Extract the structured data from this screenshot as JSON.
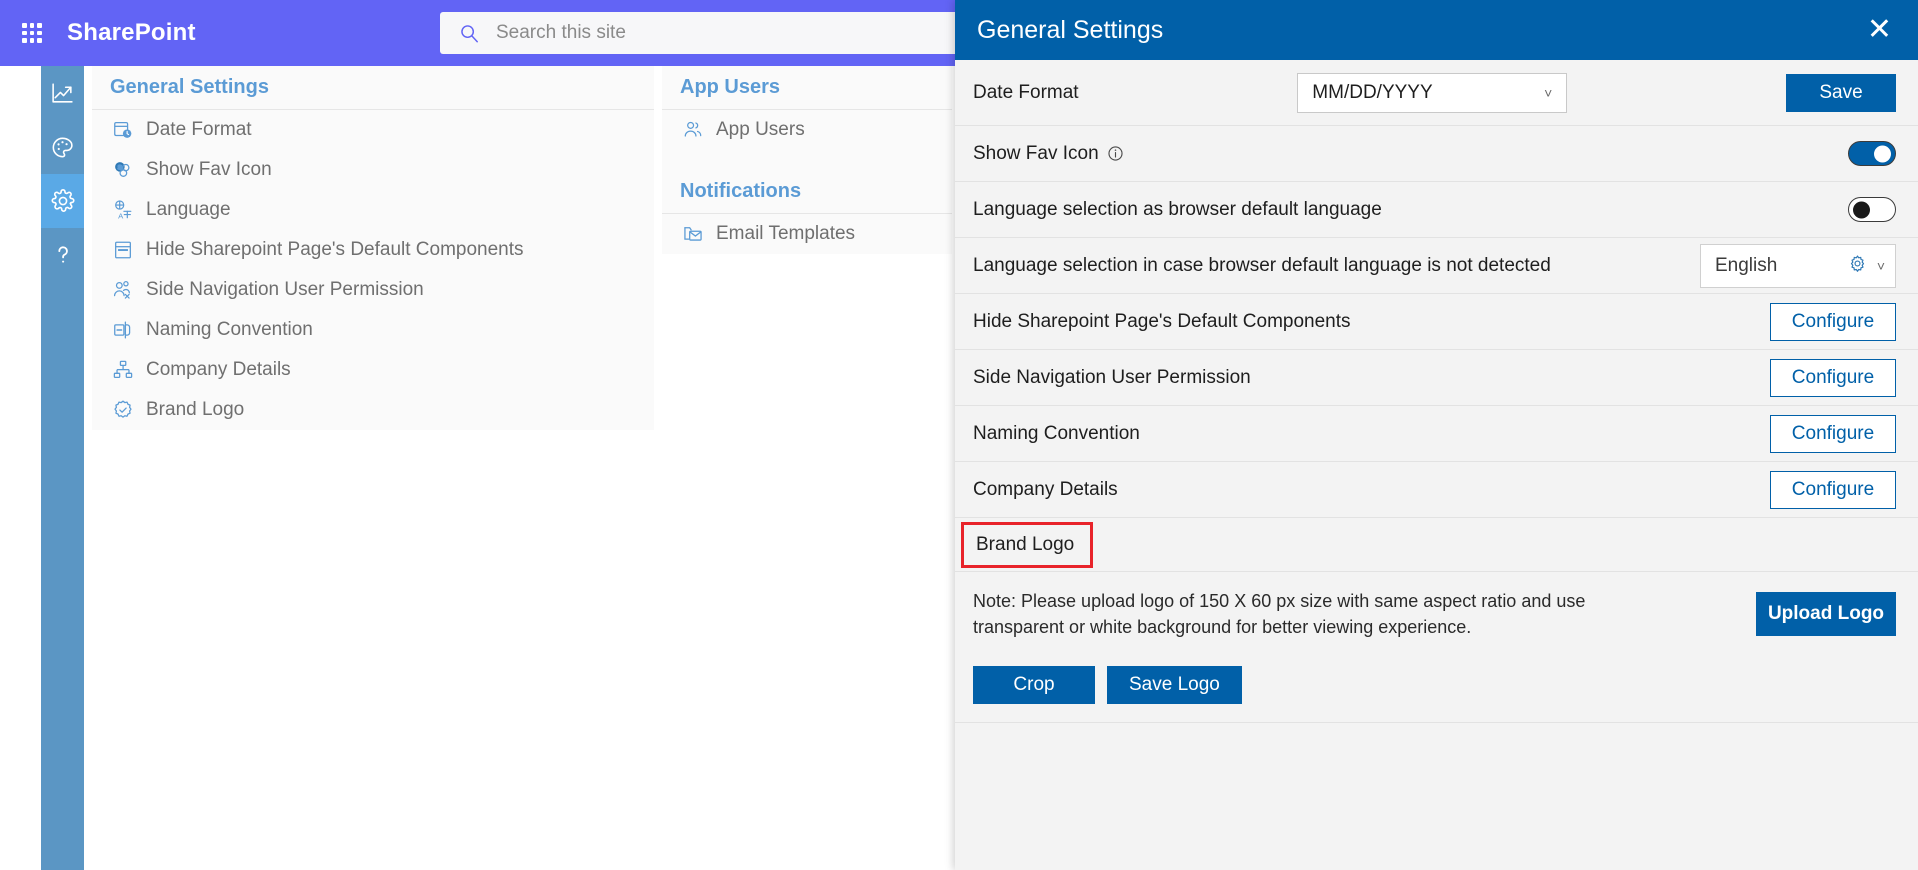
{
  "suite": {
    "waffle_icon": "app-launcher-icon",
    "brand": "SharePoint",
    "search": {
      "icon": "search-icon",
      "placeholder": "Search this site",
      "value": ""
    }
  },
  "rail": {
    "items": [
      {
        "icon": "analytics-chart-icon",
        "name": "analytics",
        "active": false
      },
      {
        "icon": "palette-icon",
        "name": "theme",
        "active": false
      },
      {
        "icon": "gear-icon",
        "name": "settings",
        "active": true
      },
      {
        "icon": "question-mark-icon",
        "name": "help",
        "active": false
      }
    ],
    "colors": {
      "bg": "#5b96c4",
      "active_bg": "#5aa9e6"
    }
  },
  "menu": {
    "columns": [
      {
        "groups": [
          {
            "heading": "General Settings",
            "items": [
              {
                "icon": "date-clock-icon",
                "label": "Date Format"
              },
              {
                "icon": "favicon-icon",
                "label": "Show Fav Icon"
              },
              {
                "icon": "translate-icon",
                "label": "Language"
              },
              {
                "icon": "page-layout-icon",
                "label": "Hide Sharepoint Page's Default Components"
              },
              {
                "icon": "user-permission-icon",
                "label": "Side Navigation User Permission"
              },
              {
                "icon": "naming-icon",
                "label": "Naming Convention"
              },
              {
                "icon": "org-chart-icon",
                "label": "Company Details"
              },
              {
                "icon": "badge-check-icon",
                "label": "Brand Logo"
              }
            ]
          }
        ]
      },
      {
        "groups": [
          {
            "heading": "App Users",
            "items": [
              {
                "icon": "people-icon",
                "label": "App Users"
              }
            ]
          },
          {
            "heading": "Notifications",
            "items": [
              {
                "icon": "mail-template-icon",
                "label": "Email Templates"
              }
            ]
          }
        ]
      }
    ]
  },
  "panel": {
    "title": "General Settings",
    "close_icon": "close-icon",
    "header_color": "#0160a8",
    "date_format": {
      "label": "Date Format",
      "value": "MM/DD/YYYY",
      "caret_icon": "chevron-down-icon",
      "save_label": "Save"
    },
    "show_fav_icon": {
      "label": "Show Fav Icon",
      "info_icon": "info-icon",
      "toggle_state": "on"
    },
    "language_browser_default": {
      "label": "Language selection as browser default language",
      "toggle_state": "off"
    },
    "language_fallback": {
      "label": "Language selection in case browser default language is not detected",
      "value": "English",
      "gear_icon": "gear-icon",
      "caret_icon": "chevron-down-icon"
    },
    "configure_rows": [
      {
        "label": "Hide Sharepoint Page's Default Components",
        "button": "Configure"
      },
      {
        "label": "Side Navigation User Permission",
        "button": "Configure"
      },
      {
        "label": "Naming Convention",
        "button": "Configure"
      },
      {
        "label": "Company Details",
        "button": "Configure"
      }
    ],
    "brand_logo": {
      "label": "Brand Logo",
      "highlight_color": "#e8232a",
      "note": "Note: Please upload logo of 150 X 60 px size with same aspect ratio and use transparent or white background for better viewing experience.",
      "upload_label": "Upload Logo",
      "crop_label": "Crop",
      "save_logo_label": "Save Logo"
    }
  }
}
